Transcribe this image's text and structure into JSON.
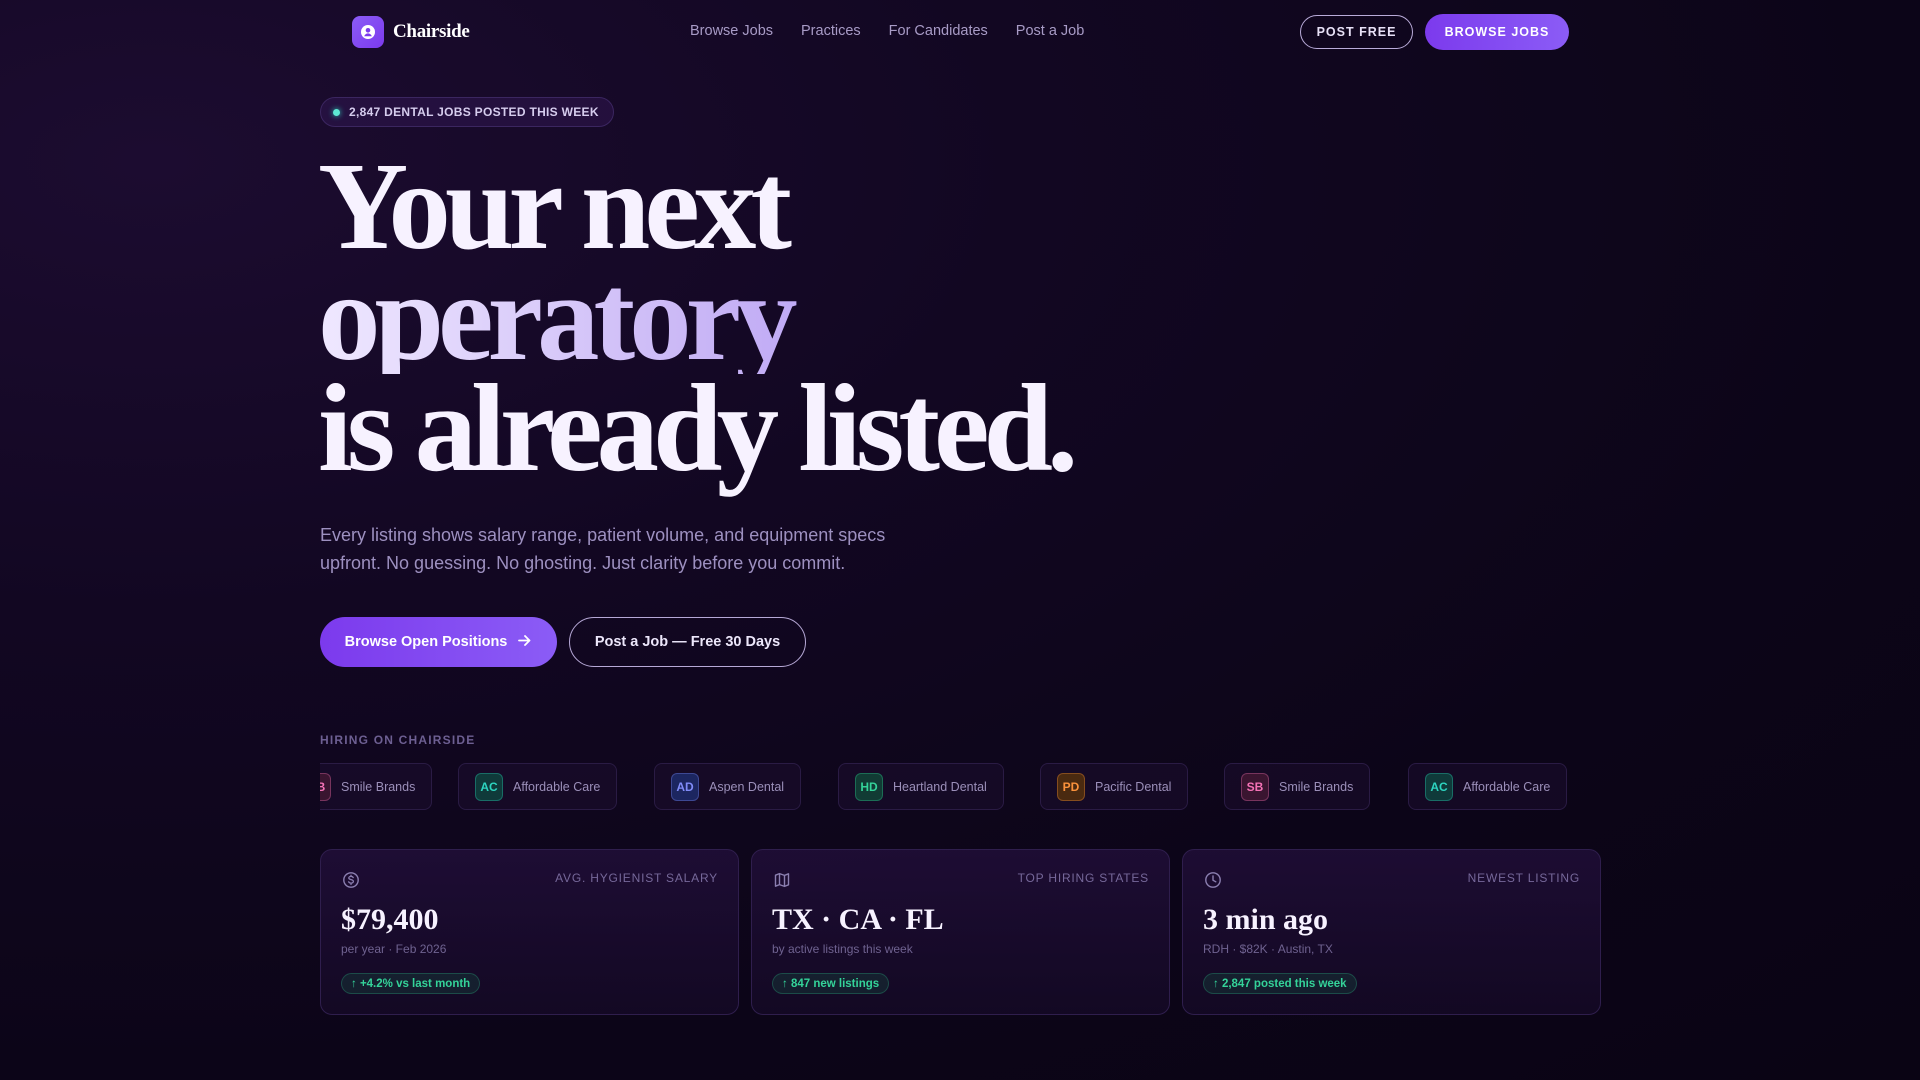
{
  "nav": {
    "brand": "Chairside",
    "links": [
      {
        "label": "Browse Jobs"
      },
      {
        "label": "Practices"
      },
      {
        "label": "For Candidates"
      },
      {
        "label": "Post a Job"
      }
    ],
    "post_free_label": "POST FREE",
    "browse_jobs_label": "BROWSE JOBS"
  },
  "hero": {
    "badge": "2,847 DENTAL JOBS POSTED THIS WEEK",
    "headline_line1": "Your next",
    "headline_line2": "operatory",
    "headline_line3": "is already listed.",
    "subcopy": "Every listing shows salary range, patient volume, and equipment specs upfront. No guessing. No ghosting. Just clarity before you commit.",
    "primary_cta": "Browse Open Positions",
    "secondary_cta": "Post a Job — Free 30 Days"
  },
  "hiring": {
    "label": "HIRING ON CHAIRSIDE",
    "companies": [
      {
        "initials": "SB",
        "name": "Smile Brands",
        "bg": "#3a1530",
        "fg": "#f472b6"
      },
      {
        "initials": "AC",
        "name": "Affordable Care",
        "bg": "#0f3a3a",
        "fg": "#2dd4bf"
      },
      {
        "initials": "AD",
        "name": "Aspen Dental",
        "bg": "#1c2660",
        "fg": "#818cf8"
      },
      {
        "initials": "HD",
        "name": "Heartland Dental",
        "bg": "#113b34",
        "fg": "#34d399"
      },
      {
        "initials": "PD",
        "name": "Pacific Dental",
        "bg": "#4a2a10",
        "fg": "#fb923c"
      },
      {
        "initials": "SB",
        "name": "Smile Brands",
        "bg": "#3a1530",
        "fg": "#f472b6"
      },
      {
        "initials": "AC",
        "name": "Affordable Care",
        "bg": "#0f3a3a",
        "fg": "#2dd4bf"
      }
    ]
  },
  "stats": [
    {
      "icon": "dollar-icon",
      "label": "AVG. HYGIENIST SALARY",
      "value": "$79,400",
      "sub": "per year · Feb 2026",
      "delta": "↑ +4.2% vs last month"
    },
    {
      "icon": "map-icon",
      "label": "TOP HIRING STATES",
      "value": "TX · CA · FL",
      "sub": "by active listings this week",
      "delta": "↑ 847 new listings"
    },
    {
      "icon": "clock-icon",
      "label": "NEWEST LISTING",
      "value": "3 min ago",
      "sub": "RDH · $82K · Austin, TX",
      "delta": "↑ 2,847 posted this week"
    }
  ],
  "colors": {
    "accent": "#8b5cf6",
    "background": "#0c0518",
    "positive": "#34d399"
  }
}
